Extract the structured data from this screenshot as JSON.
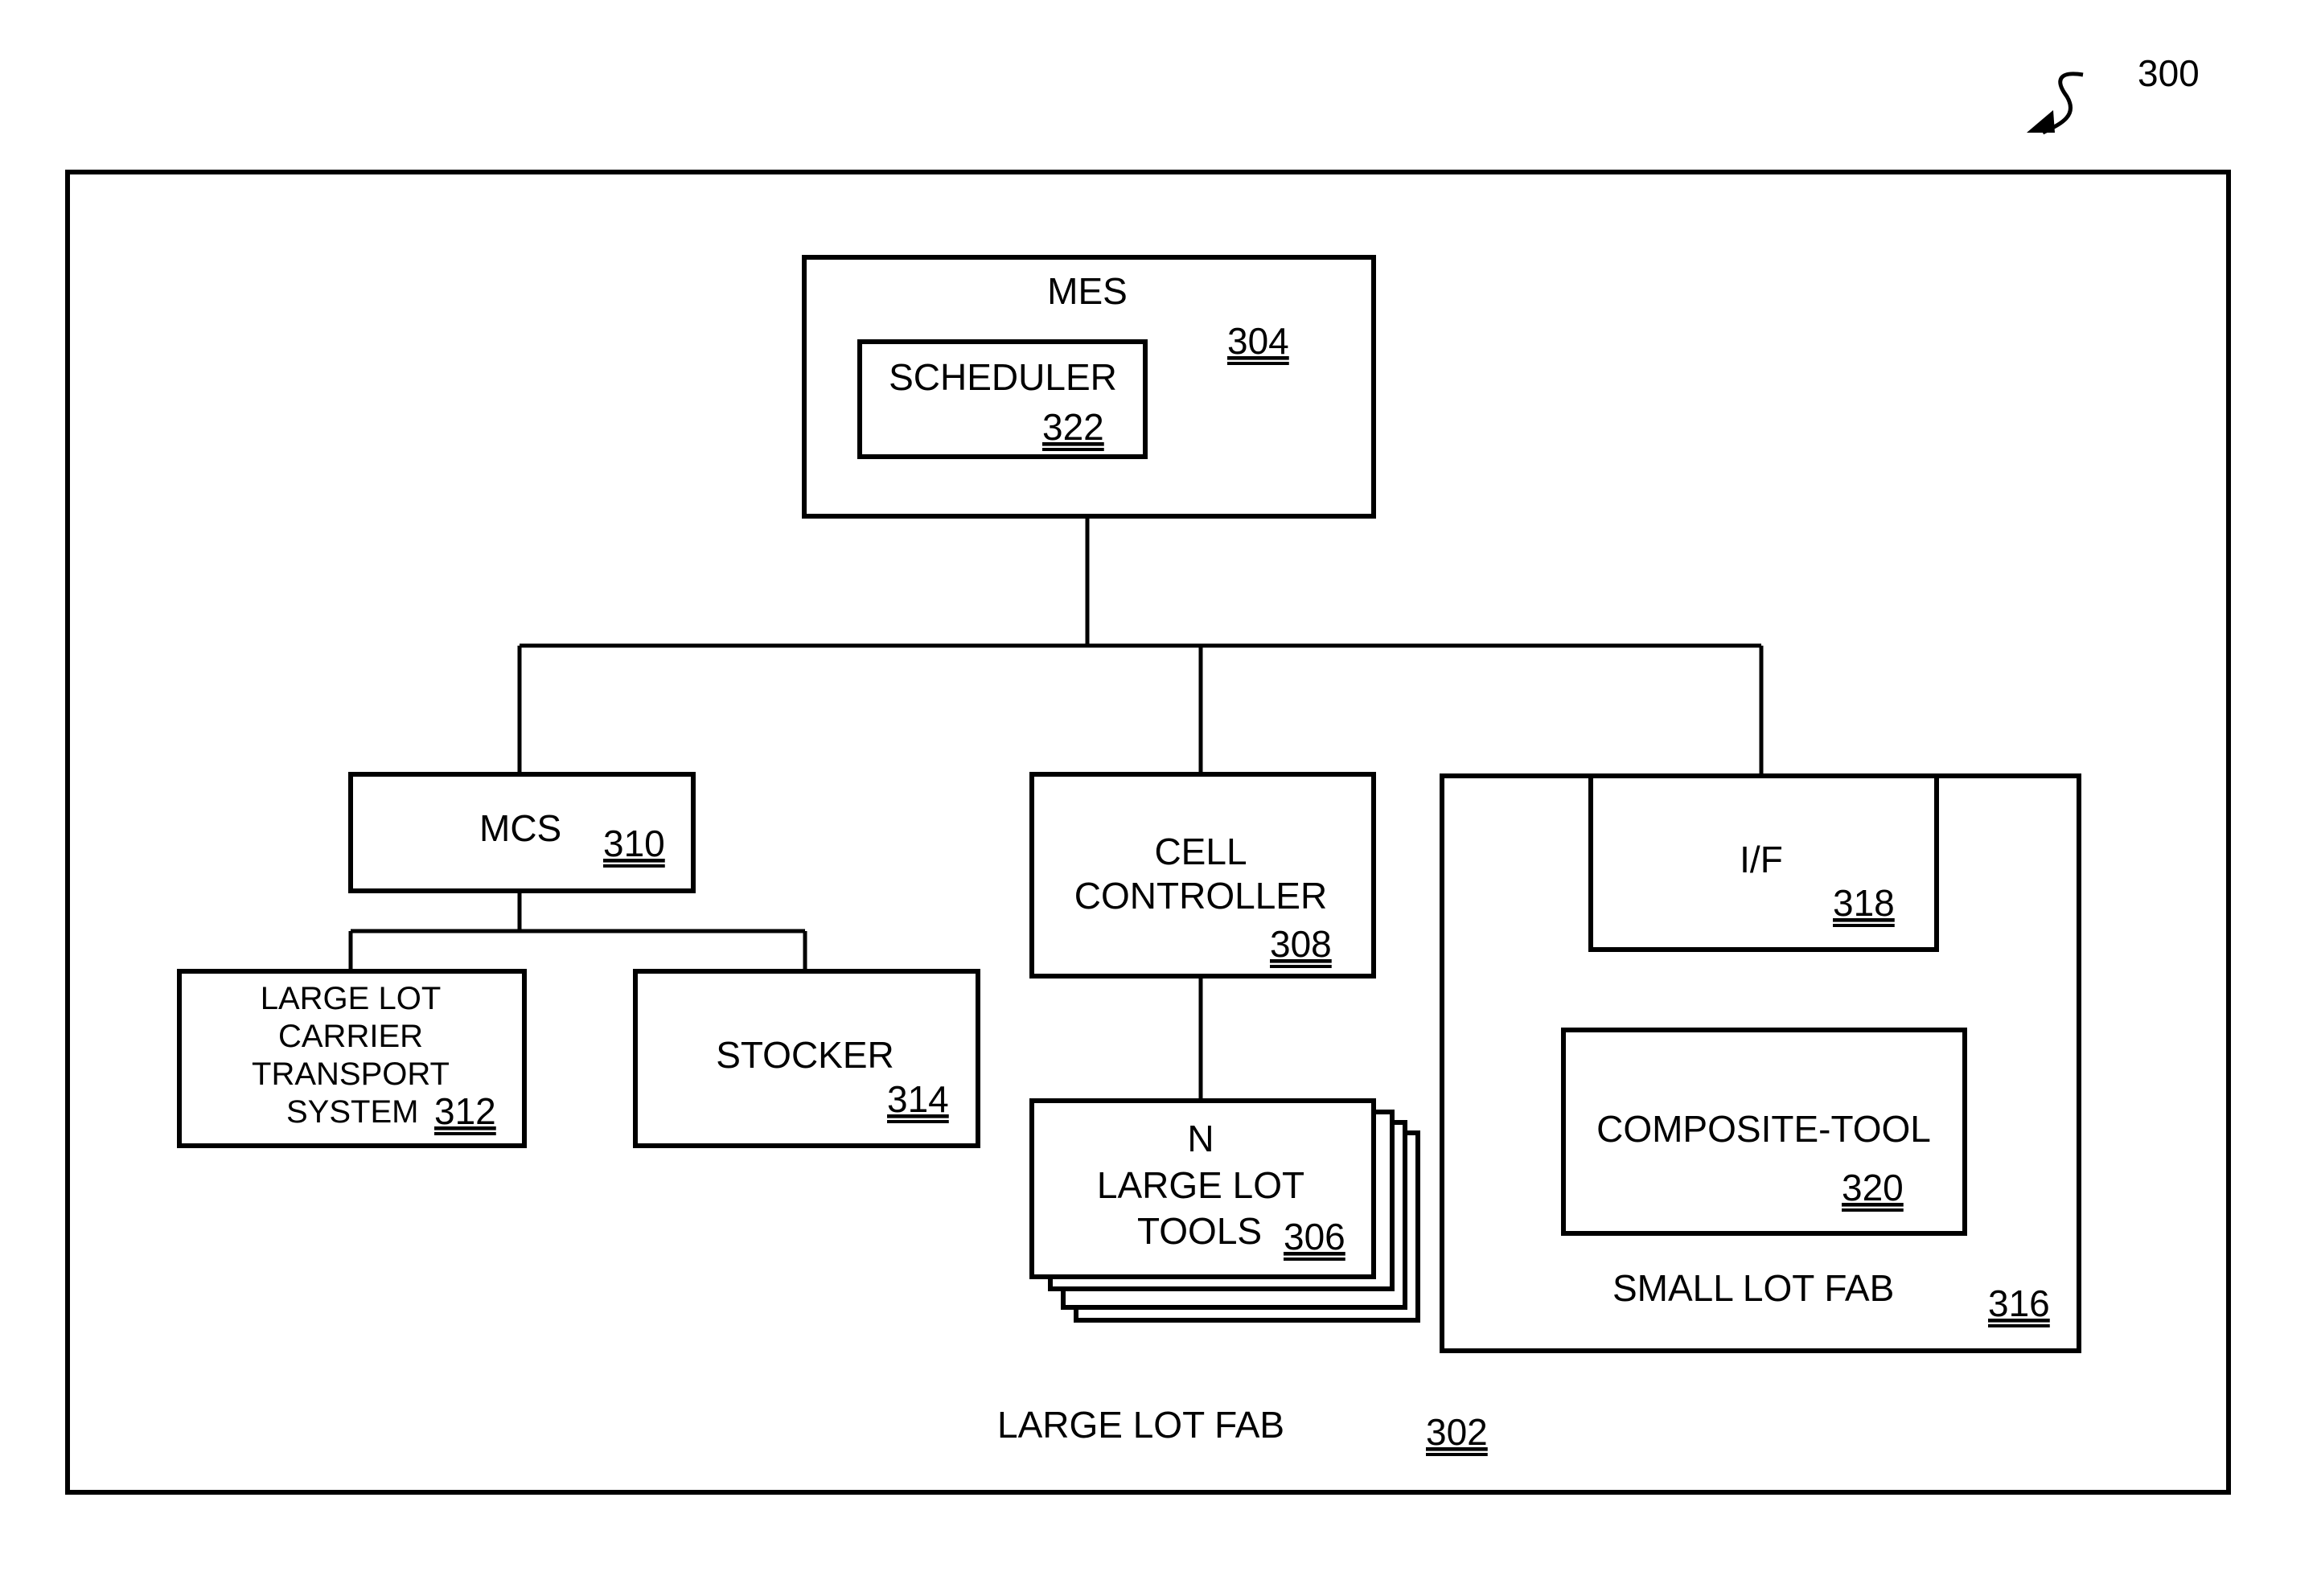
{
  "figure": {
    "ref": "300",
    "large_lot_fab": {
      "label": "LARGE LOT FAB",
      "ref": "302"
    },
    "mes": {
      "label": "MES",
      "ref": "304"
    },
    "scheduler": {
      "label": "SCHEDULER",
      "ref": "322"
    },
    "mcs": {
      "label": "MCS",
      "ref": "310"
    },
    "carrier_transport": {
      "lines": [
        "LARGE LOT",
        "CARRIER",
        "TRANSPORT",
        "SYSTEM"
      ],
      "ref": "312"
    },
    "stocker": {
      "label": "STOCKER",
      "ref": "314"
    },
    "cell_controller": {
      "lines": [
        "CELL",
        "CONTROLLER"
      ],
      "ref": "308"
    },
    "tools": {
      "lines": [
        "N",
        "LARGE LOT",
        "TOOLS"
      ],
      "ref": "306"
    },
    "small_lot_fab": {
      "label": "SMALL LOT FAB",
      "ref": "316"
    },
    "interface": {
      "label": "I/F",
      "ref": "318"
    },
    "composite_tool": {
      "label": "COMPOSITE-TOOL",
      "ref": "320"
    }
  }
}
